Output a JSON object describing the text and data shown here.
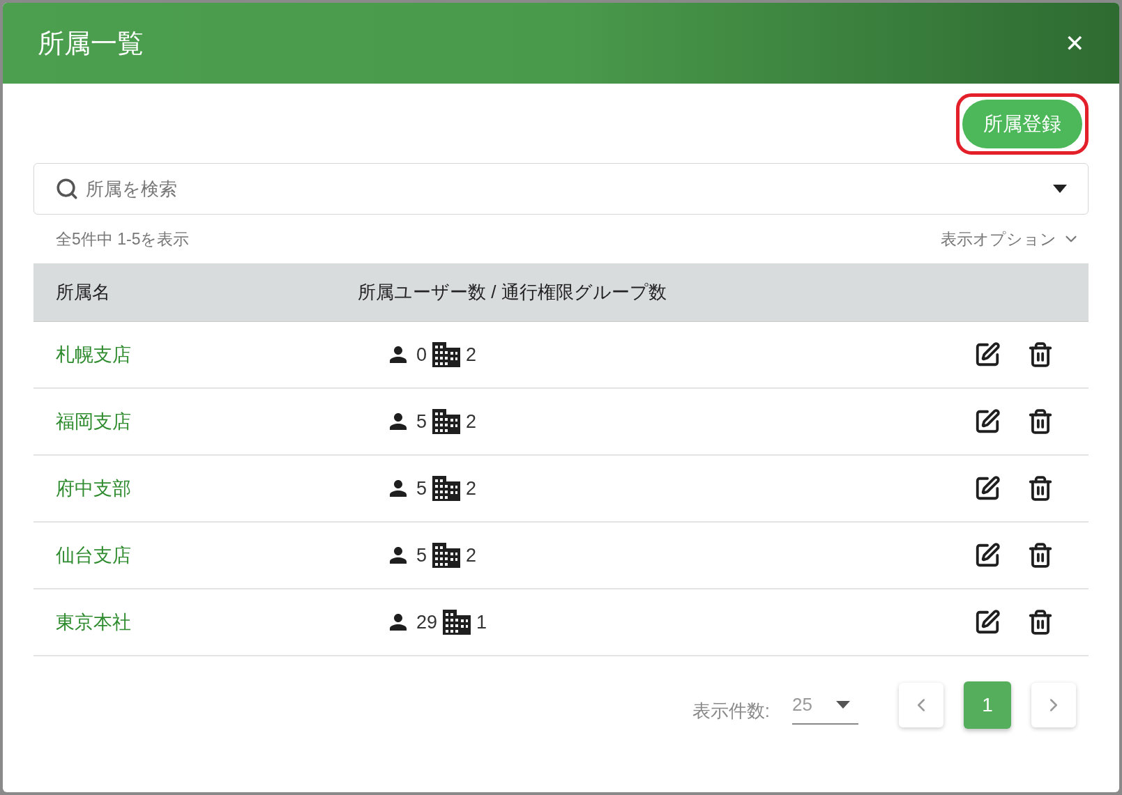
{
  "dialog": {
    "title": "所属一覧",
    "close": "✕"
  },
  "register_button": {
    "label": "所属登録",
    "highlighted": true
  },
  "search": {
    "placeholder": "所属を検索"
  },
  "summary": "全5件中 1-5を表示",
  "display_options": "表示オプション",
  "table": {
    "columns": [
      "所属名",
      "所属ユーザー数 / 通行権限グループ数"
    ],
    "rows": [
      {
        "name": "札幌支店",
        "users": "0",
        "groups": "2"
      },
      {
        "name": "福岡支店",
        "users": "5",
        "groups": "2"
      },
      {
        "name": "府中支部",
        "users": "5",
        "groups": "2"
      },
      {
        "name": "仙台支店",
        "users": "5",
        "groups": "2"
      },
      {
        "name": "東京本社",
        "users": "29",
        "groups": "1"
      }
    ]
  },
  "pagination": {
    "page_size_label": "表示件数:",
    "page_size": "25",
    "pages": [
      {
        "label": "1",
        "selected": true
      }
    ]
  }
}
